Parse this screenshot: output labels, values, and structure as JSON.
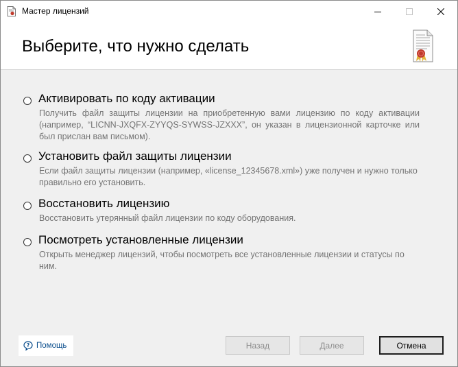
{
  "window": {
    "title": "Мастер лицензий",
    "icon": "license-document-icon"
  },
  "titlebar_controls": {
    "minimize_icon": "minimize-icon",
    "maximize_icon": "maximize-icon",
    "close_icon": "close-icon"
  },
  "header": {
    "title": "Выберите, что нужно сделать",
    "icon": "certificate-document-icon"
  },
  "options": [
    {
      "label": "Активировать по коду активации",
      "description": "Получить файл защиты лицензии на приобретенную вами лицензию по коду активации (например, “LICNN-JXQFX-ZYYQS-SYWSS-JZXXX”, он указан в лицензионной карточке или был прислан вам письмом).",
      "selected": false
    },
    {
      "label": "Установить файл защиты лицензии",
      "description": "Если файл защиты лицензии (например, «license_12345678.xml») уже получен и нужно только правильно его установить.",
      "selected": false
    },
    {
      "label": "Восстановить лицензию",
      "description": "Восстановить утерянный файл лицензии по коду оборудования.",
      "selected": false
    },
    {
      "label": "Посмотреть установленные лицензии",
      "description": "Открыть менеджер лицензий, чтобы посмотреть все установленные лицензии и статусы по ним.",
      "selected": false
    }
  ],
  "footer": {
    "help_label": "Помощь",
    "help_icon": "help-speech-bubble-icon",
    "back_label": "Назад",
    "next_label": "Далее",
    "cancel_label": "Отмена",
    "back_enabled": false,
    "next_enabled": false
  },
  "colors": {
    "background": "#f0f0f0",
    "header_background": "#ffffff",
    "description_text": "#737373",
    "help_link": "#0a4d8c",
    "seal_red": "#c0392b"
  }
}
